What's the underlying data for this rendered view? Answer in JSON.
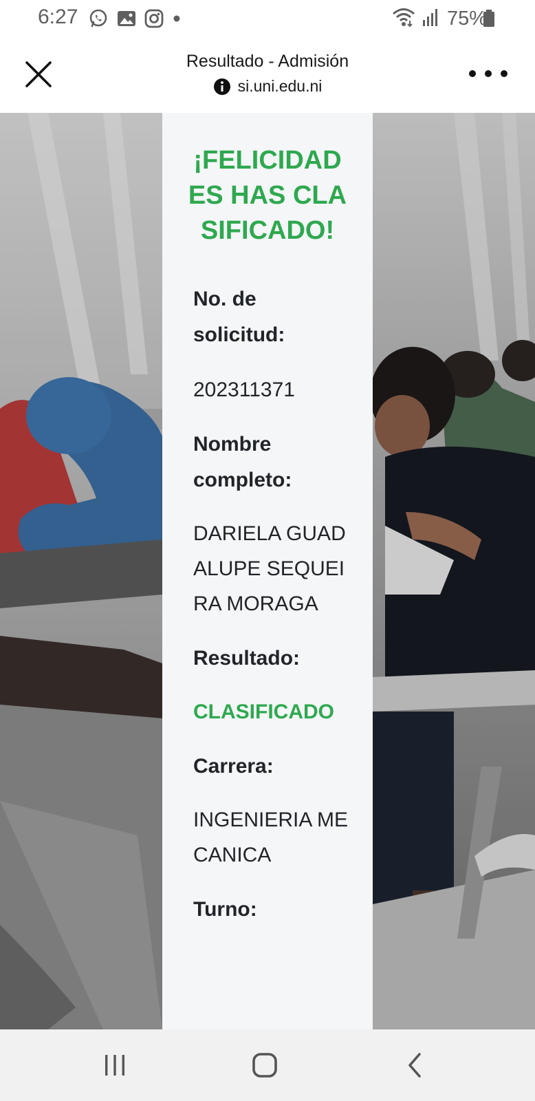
{
  "status_bar": {
    "time": "6:27",
    "battery": "75%",
    "icons": [
      "whatsapp-icon",
      "gallery-icon",
      "instagram-icon",
      "dot-icon",
      "wifi-icon",
      "signal-icon",
      "battery-icon"
    ]
  },
  "toolbar": {
    "title": "Resultado - Admisión",
    "url": "si.uni.edu.ni",
    "icons": [
      "close-icon",
      "info-icon",
      "more-icon"
    ]
  },
  "result_card": {
    "heading": "¡FELICIDADES HAS CLASIFICADO!",
    "request_label": "No. de solicitud:",
    "request_number": "202311371",
    "name_label": "Nombre completo:",
    "name_value": "DARIELA GUADALUPE SEQUEIRA MORAGA",
    "result_label": "Resultado:",
    "result_value": "CLASIFICADO",
    "career_label": "Carrera:",
    "career_value": "INGENIERIA MECANICA",
    "shift_label": "Turno:"
  },
  "colors": {
    "accent_green": "#2fa84f",
    "card_background": "#f5f6f8",
    "text_dark": "#212529"
  },
  "nav_bar": {
    "icons": [
      "recent-apps-icon",
      "home-icon",
      "back-icon"
    ]
  }
}
